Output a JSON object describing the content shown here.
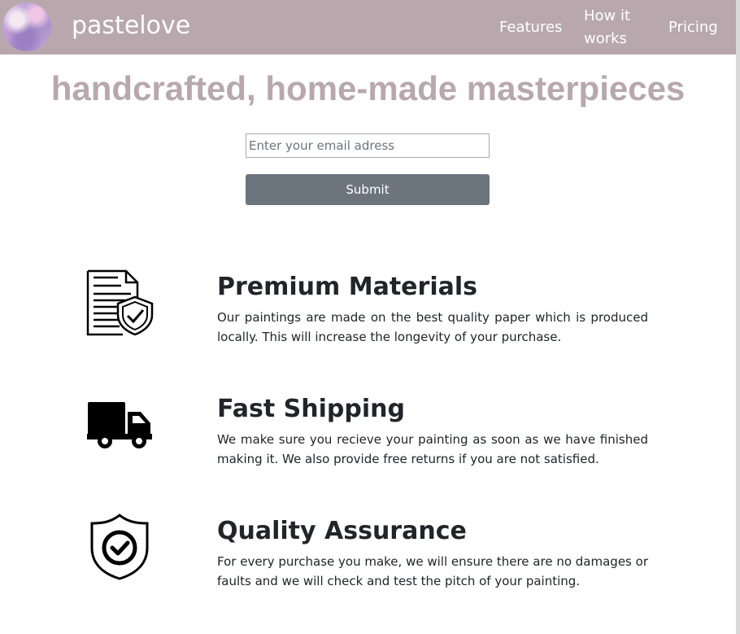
{
  "header": {
    "brand": "pastelove",
    "nav": [
      "Features",
      "How it works",
      "Pricing"
    ]
  },
  "hero": {
    "title": "handcrafted, home-made masterpieces",
    "email_placeholder": "Enter your email adress",
    "submit_label": "Submit"
  },
  "features": [
    {
      "icon": "document-shield-icon",
      "title": "Premium Materials",
      "description": "Our paintings are made on the best quality paper which is produced locally. This will increase the longevity of your purchase."
    },
    {
      "icon": "delivery-truck-icon",
      "title": "Fast Shipping",
      "description": "We make sure you recieve your painting as soon as we have finished making it. We also provide free returns if you are not satisfied."
    },
    {
      "icon": "shield-check-icon",
      "title": "Quality Assurance",
      "description": "For every purchase you make, we will ensure there are no damages or faults and we will check and test the pitch of your painting."
    }
  ],
  "colors": {
    "header_bg": "#b8a8ad",
    "title_text": "#b8a8ad",
    "button_bg": "#6c757d"
  }
}
